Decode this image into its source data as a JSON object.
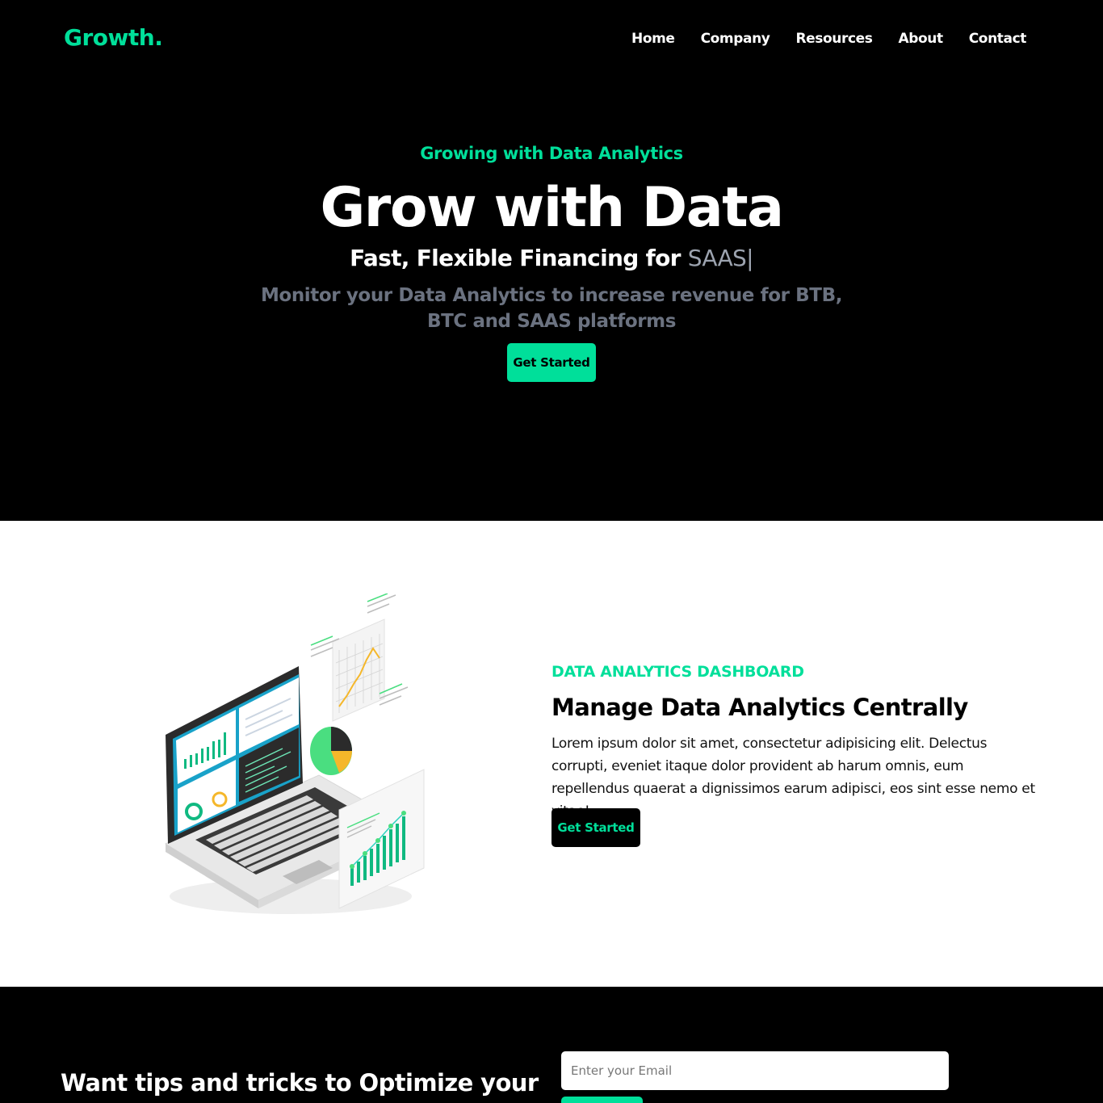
{
  "nav": {
    "logo": "Growth.",
    "links": [
      "Home",
      "Company",
      "Resources",
      "About",
      "Contact"
    ]
  },
  "hero": {
    "kicker": "Growing with Data Analytics",
    "title": "Grow with Data",
    "subtitle_prefix": "Fast, Flexible Financing for ",
    "subtitle_typed": "SAAS|",
    "description": "Monitor your Data Analytics to increase revenue for BTB, BTC and SAAS platforms",
    "cta": "Get Started"
  },
  "analytics": {
    "kicker": "DATA ANALYTICS DASHBOARD",
    "title": "Manage Data Analytics Centrally",
    "text": "Lorem ipsum dolor sit amet, consectetur adipisicing elit. Delectus corrupti, eveniet itaque dolor provident ab harum omnis, eum repellendus quaerat a dignissimos earum adipisci, eos sint esse nemo et vitae!",
    "cta": "Get Started"
  },
  "newsletter": {
    "title": "Want tips and tricks to Optimize your",
    "email_placeholder": "Enter your Email"
  },
  "colors": {
    "accent": "#00df9a",
    "background_dark": "#000000",
    "background_light": "#ffffff",
    "muted_text": "#6b7280"
  }
}
